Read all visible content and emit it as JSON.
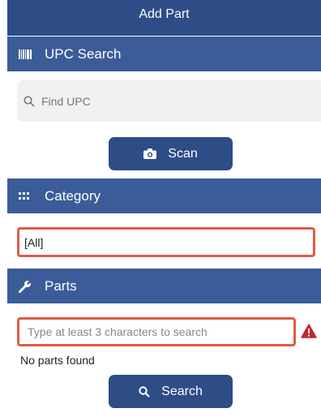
{
  "header": {
    "title": "Add Part"
  },
  "upc": {
    "section_label": "UPC Search",
    "search_placeholder": "Find UPC",
    "scan_label": "Scan"
  },
  "category": {
    "section_label": "Category",
    "value": "[All]"
  },
  "parts": {
    "section_label": "Parts",
    "search_placeholder": "Type at least 3 characters to search",
    "empty_message": "No parts found",
    "search_label": "Search"
  },
  "colors": {
    "header_bg": "#2e4c86",
    "section_bg": "#3b5c98",
    "button_bg": "#2e4c86",
    "highlight_border": "#e25a48",
    "warning": "#c62828"
  },
  "icons": {
    "upc": "barcode-icon",
    "scan": "camera-icon",
    "category": "grid-icon",
    "parts": "wrench-icon",
    "search": "magnifier-icon",
    "warning": "warning-triangle-icon"
  }
}
